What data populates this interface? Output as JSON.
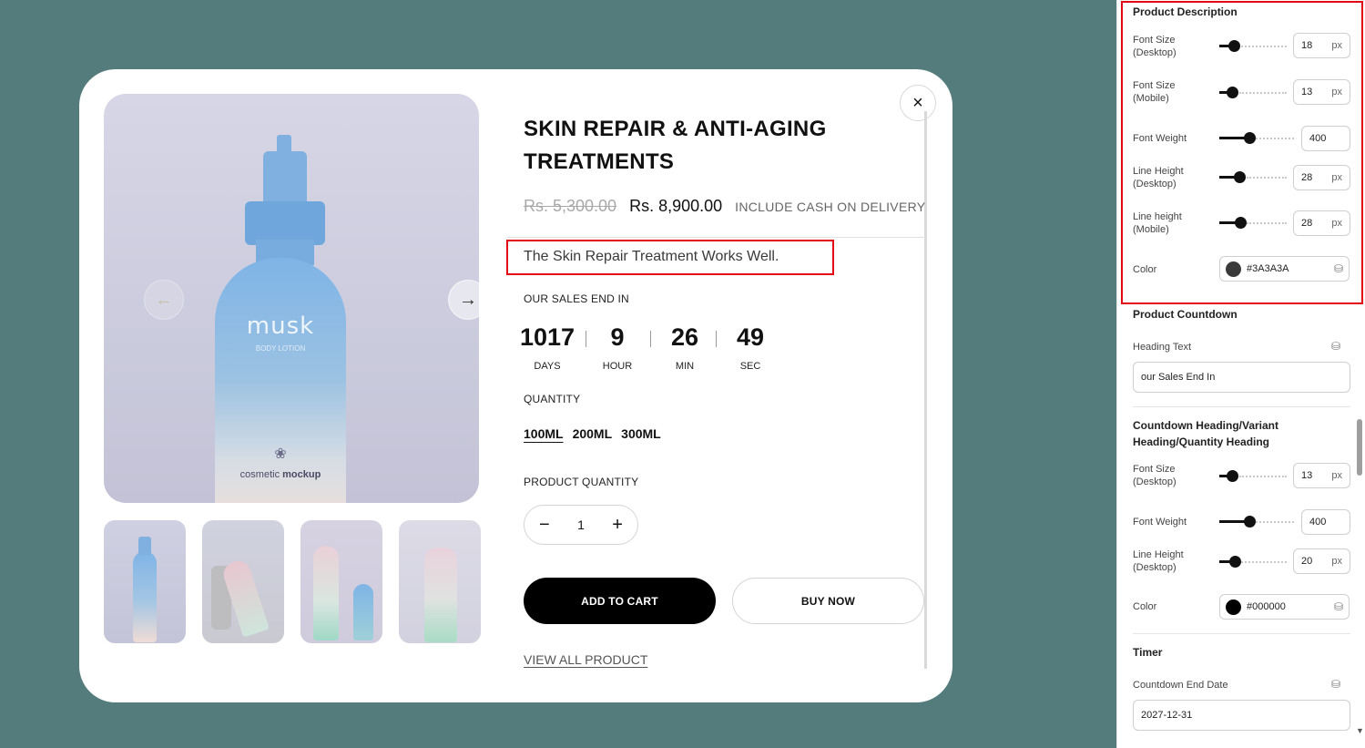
{
  "product": {
    "title": "SKIN REPAIR & ANTI-AGING TREATMENTS",
    "old_price": "Rs. 5,300.00",
    "new_price": "Rs. 8,900.00",
    "cod_note": "INCLUDE CASH ON DELIVERY",
    "description": "The Skin Repair Treatment Works Well.",
    "image_brand": "musk",
    "image_sub": "BODY LOTION",
    "image_mockup_a": "cosmetic",
    "image_mockup_b": "mockup",
    "close_icon": "×",
    "prev_icon": "←",
    "next_icon": "→"
  },
  "countdown": {
    "heading": "OUR SALES END IN",
    "days": "1017",
    "days_label": "DAYS",
    "hours": "9",
    "hours_label": "HOUR",
    "minutes": "26",
    "minutes_label": "MIN",
    "seconds": "49",
    "seconds_label": "SEC"
  },
  "quantity": {
    "heading": "QUANTITY",
    "variants": [
      "100ML",
      "200ML",
      "300ML"
    ],
    "selected": "100ML"
  },
  "product_quantity": {
    "heading": "PRODUCT QUANTITY",
    "minus": "−",
    "value": "1",
    "plus": "+"
  },
  "actions": {
    "add_to_cart": "ADD TO CART",
    "buy_now": "BUY NOW",
    "view_all": "VIEW ALL PRODUCT"
  },
  "panel": {
    "description_section": {
      "title": "Product Description",
      "font_size_desktop_label": [
        "Font Size",
        "(Desktop)"
      ],
      "font_size_desktop": "18",
      "font_size_mobile_label": [
        "Font Size",
        "(Mobile)"
      ],
      "font_size_mobile": "13",
      "font_weight_label": "Font Weight",
      "font_weight": "400",
      "line_height_desktop_label": [
        "Line Height",
        "(Desktop)"
      ],
      "line_height_desktop": "28",
      "line_height_mobile_label": [
        "Line height",
        "(Mobile)"
      ],
      "line_height_mobile": "28",
      "color_label": "Color",
      "color": "#3A3A3A",
      "unit": "px"
    },
    "countdown_section": {
      "title": "Product Countdown",
      "heading_text_label": "Heading Text",
      "heading_text": "our Sales End In"
    },
    "heading_section": {
      "title_line1": "Countdown Heading/Variant",
      "title_line2": "Heading/Quantity Heading",
      "font_size_desktop_label": [
        "Font Size",
        "(Desktop)"
      ],
      "font_size_desktop": "13",
      "font_weight_label": "Font Weight",
      "font_weight": "400",
      "line_height_desktop_label": [
        "Line Height",
        "(Desktop)"
      ],
      "line_height_desktop": "20",
      "color_label": "Color",
      "color": "#000000"
    },
    "timer_section": {
      "title": "Timer",
      "end_date_label": "Countdown End Date",
      "end_date": "2027-12-31"
    },
    "icons": {
      "database": "⛁"
    }
  },
  "colors": {
    "preview_bg": "#557c7c",
    "highlight": "#e30613",
    "desc_color": "#3a3a3a"
  }
}
